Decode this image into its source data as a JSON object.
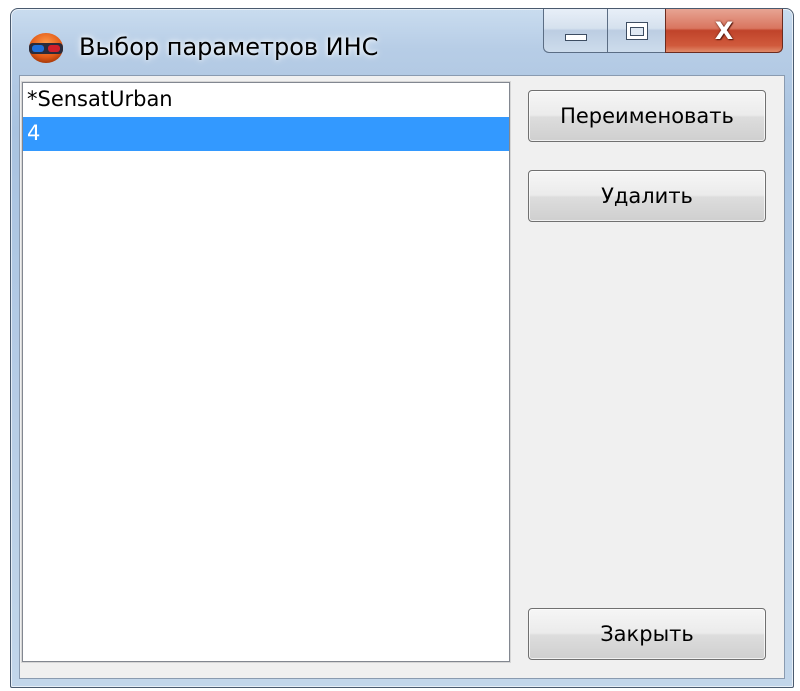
{
  "window": {
    "title": "Выбор параметров ИНС",
    "app_icon": "3d-glasses-icon",
    "caption": {
      "minimize_icon": "minimize-icon",
      "maximize_icon": "maximize-icon",
      "close_glyph": "X",
      "close_icon": "close-icon"
    }
  },
  "list": {
    "items": [
      {
        "label": "*SensatUrban",
        "selected": false
      },
      {
        "label": "4",
        "selected": true
      }
    ],
    "selection_color": "#3399ff"
  },
  "buttons": {
    "rename_label": "Переименовать",
    "delete_label": "Удалить",
    "close_label": "Закрыть"
  }
}
